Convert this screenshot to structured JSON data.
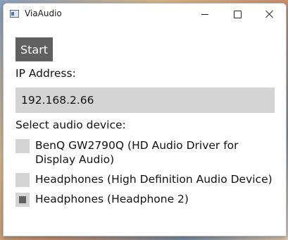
{
  "window": {
    "title": "ViaAudio",
    "controls": {
      "minimize_icon": "minimize-icon",
      "maximize_icon": "maximize-icon",
      "close_icon": "close-icon"
    }
  },
  "main": {
    "start_label": "Start",
    "ip_label": "IP Address:",
    "ip_value": "192.168.2.66",
    "device_label": "Select audio device:",
    "devices": [
      {
        "label": "BenQ GW2790Q (HD Audio Driver for Display Audio)",
        "checked": false
      },
      {
        "label": "Headphones (High Definition Audio Device)",
        "checked": false
      },
      {
        "label": "Headphones (Headphone 2)",
        "checked": true
      }
    ]
  },
  "colors": {
    "button_bg": "#606060",
    "field_bg": "#d4d4d4"
  }
}
